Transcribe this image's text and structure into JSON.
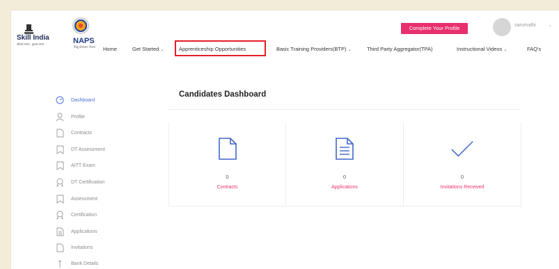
{
  "header": {
    "logo_skill_text": "Skill India",
    "logo_skill_sub": "कौशल भारत - कुशल भारत",
    "logo_naps_text": "NAPS",
    "logo_naps_sub": "शिक्षु प्रोत्साहन योजना",
    "cta_label": "Complete Your Profile",
    "username": "sarumathi",
    "nav": [
      {
        "label": "Home"
      },
      {
        "label": "Get Started"
      },
      {
        "label": "Apprenticeship Opportunities"
      },
      {
        "label": "Basic Training Providers(BTP)"
      },
      {
        "label": "Third Party Aggregator(TPA)"
      },
      {
        "label": "Instructional Videos"
      },
      {
        "label": "FAQ's"
      }
    ]
  },
  "sidebar": {
    "items": [
      {
        "label": "Dashboard",
        "icon": "gauge-icon"
      },
      {
        "label": "Profile",
        "icon": "user-icon"
      },
      {
        "label": "Contracts",
        "icon": "document-icon"
      },
      {
        "label": "DT Assessment",
        "icon": "bookmark-icon"
      },
      {
        "label": "AITT Exam",
        "icon": "bookmark-icon"
      },
      {
        "label": "DT Certification",
        "icon": "certificate-icon"
      },
      {
        "label": "Assessment",
        "icon": "bookmark-icon"
      },
      {
        "label": "Certification",
        "icon": "certificate-icon"
      },
      {
        "label": "Applications",
        "icon": "file-text-icon"
      },
      {
        "label": "Invitations",
        "icon": "document-icon"
      },
      {
        "label": "Bank Details",
        "icon": "bank-icon"
      }
    ]
  },
  "main": {
    "title": "Candidates Dashboard",
    "cards": [
      {
        "value": "0",
        "label": "Contracts",
        "icon": "document-icon"
      },
      {
        "value": "0",
        "label": "Applications",
        "icon": "file-text-icon"
      },
      {
        "value": "0",
        "label": "Invitations Received",
        "icon": "checkmark-icon"
      }
    ]
  },
  "colors": {
    "accent_pink": "#e8306e",
    "active_blue": "#4a6fd6",
    "highlight_red": "#e31e24"
  }
}
